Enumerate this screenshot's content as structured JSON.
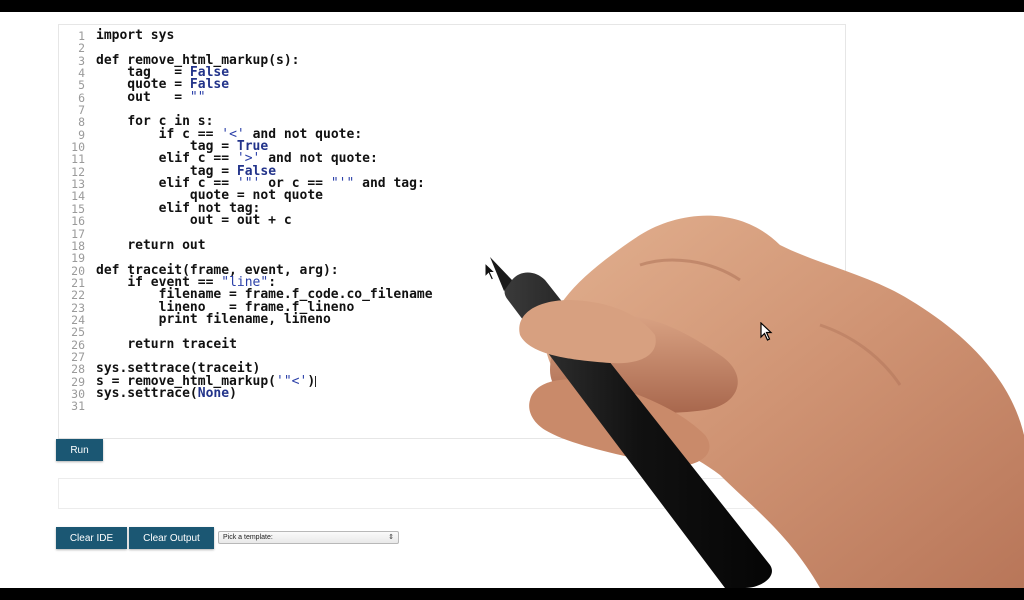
{
  "editor": {
    "lines": [
      {
        "n": "1",
        "html": "<span class='kw'>import</span> sys"
      },
      {
        "n": "2",
        "html": ""
      },
      {
        "n": "3",
        "html": "<span class='kw'>def</span> remove_html_markup(s):"
      },
      {
        "n": "4",
        "html": "    tag   = <span class='const'>False</span>"
      },
      {
        "n": "5",
        "html": "    quote = <span class='const'>False</span>"
      },
      {
        "n": "6",
        "html": "    out   = <span class='str'>\"\"</span>"
      },
      {
        "n": "7",
        "html": ""
      },
      {
        "n": "8",
        "html": "    <span class='kw'>for</span> c <span class='kw'>in</span> s:"
      },
      {
        "n": "9",
        "html": "        <span class='kw'>if</span> c == <span class='str'>'&lt;'</span> <span class='kw'>and not</span> quote:"
      },
      {
        "n": "10",
        "html": "            tag = <span class='const'>True</span>"
      },
      {
        "n": "11",
        "html": "        <span class='kw'>elif</span> c == <span class='str'>'&gt;'</span> <span class='kw'>and not</span> quote:"
      },
      {
        "n": "12",
        "html": "            tag = <span class='const'>False</span>"
      },
      {
        "n": "13",
        "html": "        <span class='kw'>elif</span> c == <span class='str'>'\"'</span> <span class='kw'>or</span> c == <span class='str'>\"'\"</span> <span class='kw'>and</span> tag:"
      },
      {
        "n": "14",
        "html": "            quote = <span class='kw'>not</span> quote"
      },
      {
        "n": "15",
        "html": "        <span class='kw'>elif not</span> tag:"
      },
      {
        "n": "16",
        "html": "            out = out + c"
      },
      {
        "n": "17",
        "html": ""
      },
      {
        "n": "18",
        "html": "    <span class='kw'>return</span> out"
      },
      {
        "n": "19",
        "html": ""
      },
      {
        "n": "20",
        "html": "<span class='kw'>def</span> traceit(frame, event, arg):"
      },
      {
        "n": "21",
        "html": "    <span class='kw'>if</span> event == <span class='str'>\"line\"</span>:"
      },
      {
        "n": "22",
        "html": "        filename = frame.f_code.co_filename"
      },
      {
        "n": "23",
        "html": "        lineno   = frame.f_lineno"
      },
      {
        "n": "24",
        "html": "        <span class='kw'>print</span> filename, lineno"
      },
      {
        "n": "25",
        "html": ""
      },
      {
        "n": "26",
        "html": "    <span class='kw'>return</span> traceit"
      },
      {
        "n": "27",
        "html": ""
      },
      {
        "n": "28",
        "html": "sys.settrace(traceit)"
      },
      {
        "n": "29",
        "html": "s = remove_html_markup(<span class='str'>'\"&lt;'</span>)<span class='cursor-caret'></span>"
      },
      {
        "n": "30",
        "html": "sys.settrace(<span class='const'>None</span>)"
      },
      {
        "n": "31",
        "html": ""
      }
    ]
  },
  "controls": {
    "run_label": "Run",
    "clear_ide_label": "Clear IDE",
    "clear_output_label": "Clear Output",
    "template_select_value": "Pick a template:",
    "select_arrows": "⇕"
  },
  "colors": {
    "button_bg": "#1b5773",
    "string": "#2a3fa8"
  }
}
